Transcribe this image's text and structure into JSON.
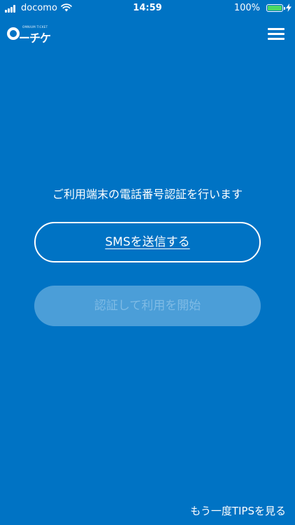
{
  "status_bar": {
    "carrier": "docomo",
    "time": "14:59",
    "battery_percent": "100%",
    "signal_icon": "cellular-signal-icon",
    "wifi_icon": "wifi-icon",
    "battery_icon": "battery-icon",
    "charging_icon": "charging-bolt-icon",
    "battery_fill": 1.0
  },
  "header": {
    "logo_small_text": "OMNIUM TICKET",
    "logo_text": "ーチケ",
    "menu_icon": "hamburger-menu-icon"
  },
  "main": {
    "prompt": "ご利用端末の電話番号認証を行います",
    "sms_button_label": "SMSを送信する",
    "start_button_label": "認証して利用を開始"
  },
  "footer": {
    "tips_link": "もう一度TIPSを見る"
  },
  "colors": {
    "background": "#0073c4",
    "disabled_button_bg": "#4b9ed8",
    "disabled_button_text": "#7fbbe5",
    "battery_green": "#4cd964"
  }
}
